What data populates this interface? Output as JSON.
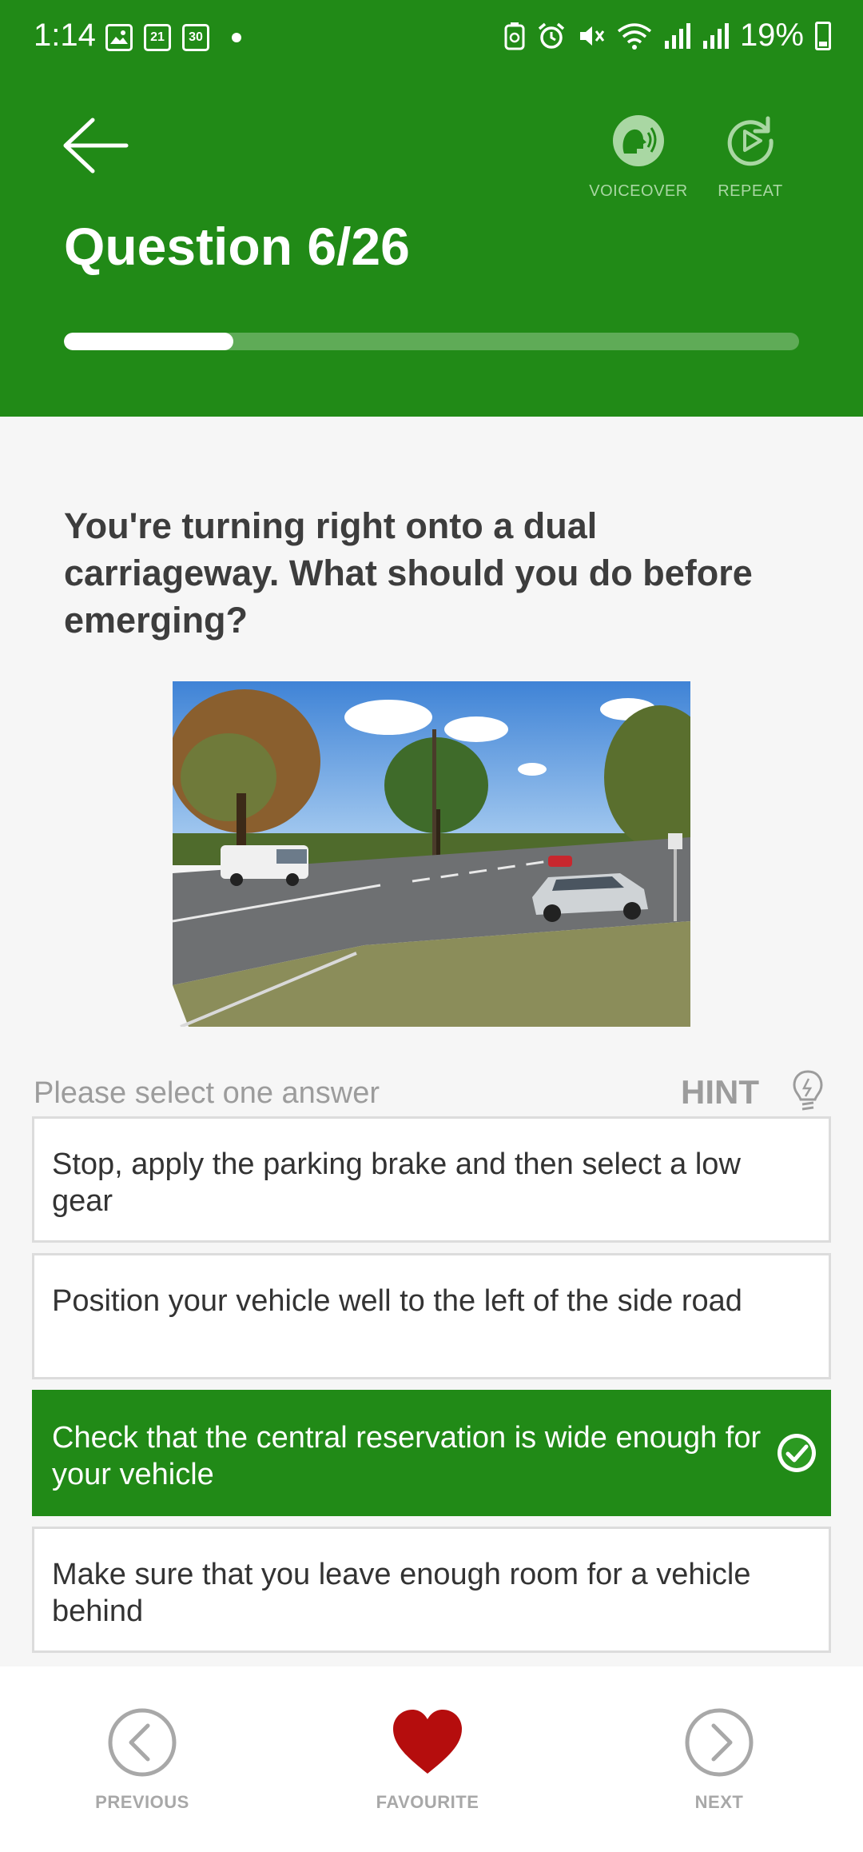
{
  "status_bar": {
    "time": "1:14",
    "date_icons": [
      "21",
      "30"
    ],
    "battery": "19%"
  },
  "header": {
    "title": "Question 6/26",
    "voiceover_label": "VOICEOVER",
    "repeat_label": "REPEAT",
    "progress": 0.2308,
    "color": "#218a17"
  },
  "question": {
    "text": "You're turning right onto a dual carriageway. What should you do before emerging?"
  },
  "answers": {
    "instruction": "Please select one answer",
    "hint_label": "HINT",
    "options": [
      {
        "text": "Stop, apply the parking brake and then select a low gear",
        "selected": false
      },
      {
        "text": "Position your vehicle well to the left of the side road",
        "selected": false
      },
      {
        "text": "Check that the central reservation is wide enough for your vehicle",
        "selected": true
      },
      {
        "text": "Make sure that you leave enough room for a vehicle behind",
        "selected": false
      }
    ]
  },
  "bottom_nav": {
    "previous_label": "PREVIOUS",
    "favourite_label": "FAVOURITE",
    "next_label": "NEXT",
    "favourite_color": "#b50d0d"
  }
}
